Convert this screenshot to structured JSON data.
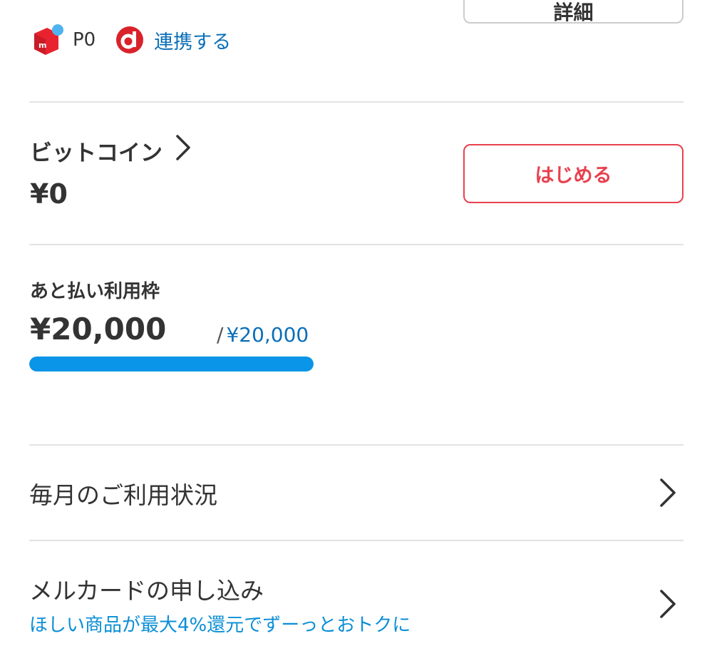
{
  "top_button": {
    "label": "詳細"
  },
  "points": {
    "merpoint_value": "P0",
    "dpoint_link": "連携する"
  },
  "bitcoin": {
    "title": "ビットコイン",
    "value": "¥0",
    "start_label": "はじめる"
  },
  "credit": {
    "title": "あと払い利用枠",
    "available": "¥20,000",
    "slash": "/",
    "limit": "¥20,000",
    "usage_fraction": 1.0,
    "bar_color": "#0a95e8"
  },
  "menu": {
    "monthly_usage": "毎月のご利用状況",
    "mercard_apply": "メルカードの申し込み",
    "mercard_sub": "ほしい商品が最大4%還元でずーっとおトクに"
  },
  "colors": {
    "accent_red": "#e8404e",
    "link_blue": "#0b6fb8",
    "progress_blue": "#0a95e8"
  },
  "icons": {
    "merpoint": "mercari-point-icon",
    "dpoint": "d-point-icon",
    "chevron": "chevron-right-icon"
  }
}
